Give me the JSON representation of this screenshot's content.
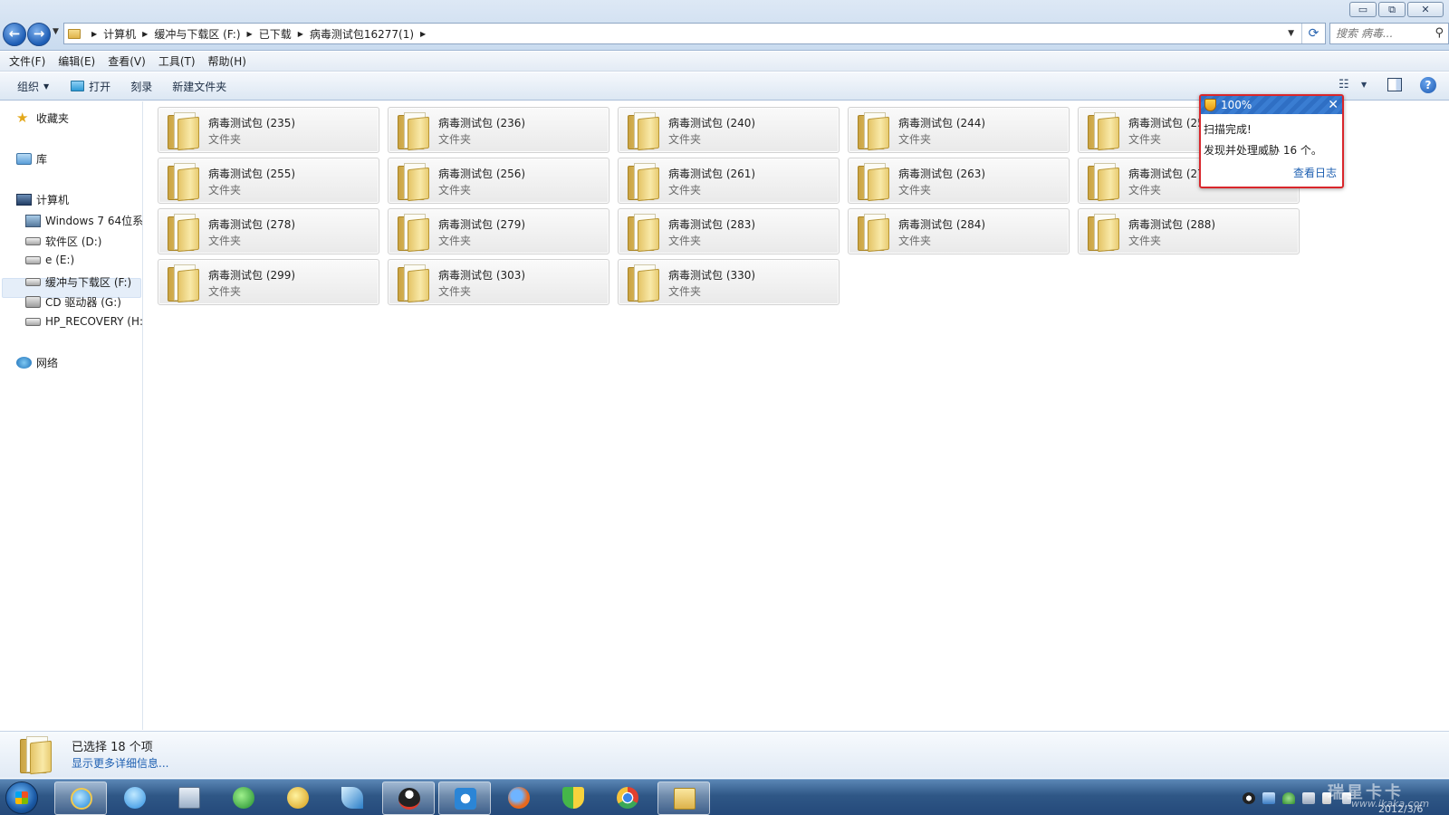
{
  "window": {
    "minimize_label": "▭",
    "restore_label": "⧉",
    "close_label": "✕"
  },
  "address": {
    "crumbs": [
      "计算机",
      "缓冲与下载区 (F:)",
      "已下载",
      "病毒测试包16277(1)"
    ]
  },
  "search": {
    "placeholder": "搜索 病毒..."
  },
  "menu": [
    "文件(F)",
    "编辑(E)",
    "查看(V)",
    "工具(T)",
    "帮助(H)"
  ],
  "toolbar": {
    "organize": "组织",
    "open": "打开",
    "burn": "刻录",
    "new_folder": "新建文件夹"
  },
  "nav": {
    "favorites": "收藏夹",
    "libraries": "库",
    "computer": "计算机",
    "drives": [
      "Windows 7 64位系",
      "软件区 (D:)",
      "e (E:)",
      "缓冲与下载区 (F:)",
      "CD 驱动器 (G:)",
      "HP_RECOVERY (H:)"
    ],
    "network": "网络"
  },
  "files": {
    "type_label": "文件夹",
    "items": [
      "病毒测试包 (235)",
      "病毒测试包 (236)",
      "病毒测试包 (240)",
      "病毒测试包 (244)",
      "病毒测试包 (25",
      "病毒测试包 (255)",
      "病毒测试包 (256)",
      "病毒测试包 (261)",
      "病毒测试包 (263)",
      "病毒测试包 (27",
      "病毒测试包 (278)",
      "病毒测试包 (279)",
      "病毒测试包 (283)",
      "病毒测试包 (284)",
      "病毒测试包 (288)",
      "病毒测试包 (299)",
      "病毒测试包 (303)",
      "病毒测试包 (330)"
    ]
  },
  "antivirus": {
    "progress_label": "100%",
    "line1": "扫描完成!",
    "line2": "发现并处理威胁  16 个。",
    "log_link": "查看日志",
    "close_label": "✕"
  },
  "details": {
    "selected": "已选择 18 个项",
    "more_link": "显示更多详细信息..."
  },
  "taskbar": {
    "watermark": "瑞星卡卡",
    "watermark_url": "www.ikaka.com",
    "date": "2012/3/6"
  },
  "colors": {
    "accent": "#1d5fb1",
    "popup_border": "#d9262b",
    "taskbar": "#2f5786"
  }
}
